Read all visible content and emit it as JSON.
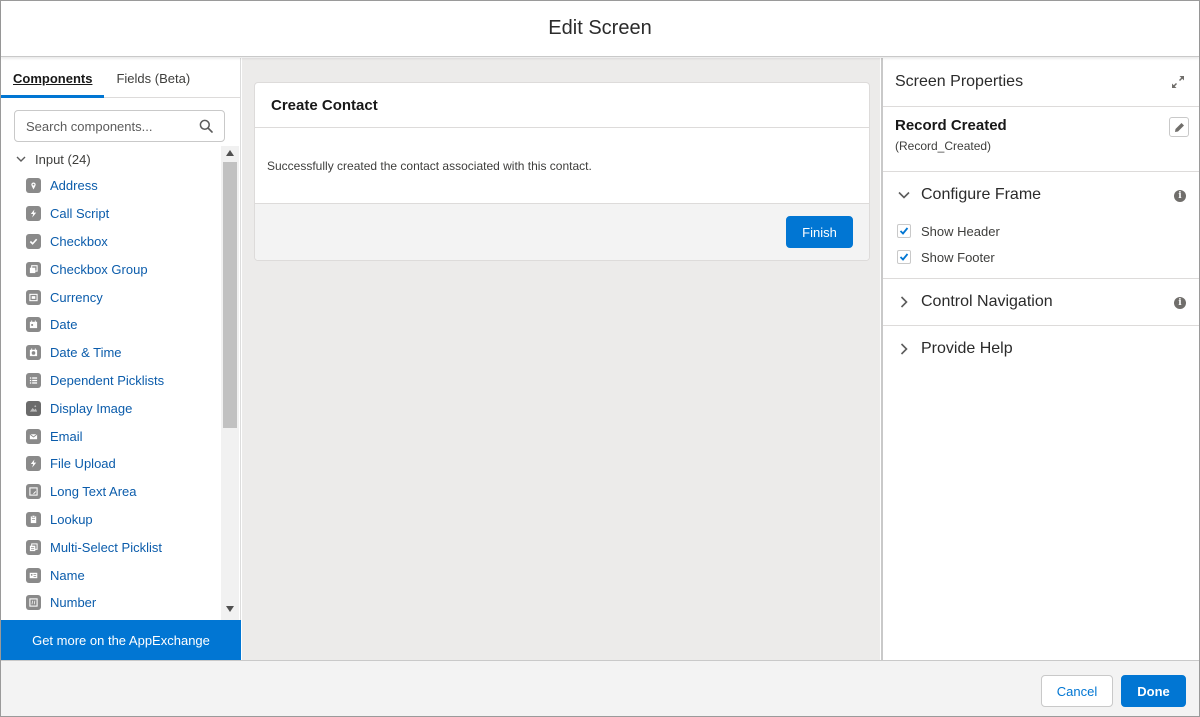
{
  "header": {
    "title": "Edit Screen"
  },
  "left": {
    "tabs": [
      {
        "label": "Components",
        "active": true
      },
      {
        "label": "Fields (Beta)",
        "active": false
      }
    ],
    "search": {
      "placeholder": "Search components..."
    },
    "group": {
      "label": "Input (24)"
    },
    "items": [
      {
        "label": "Address",
        "icon": "map-pin-icon"
      },
      {
        "label": "Call Script",
        "icon": "bolt-icon"
      },
      {
        "label": "Checkbox",
        "icon": "checkbox-icon"
      },
      {
        "label": "Checkbox Group",
        "icon": "checkbox-group-icon"
      },
      {
        "label": "Currency",
        "icon": "currency-icon"
      },
      {
        "label": "Date",
        "icon": "calendar-icon"
      },
      {
        "label": "Date & Time",
        "icon": "calendar-time-icon"
      },
      {
        "label": "Dependent Picklists",
        "icon": "list-icon"
      },
      {
        "label": "Display Image",
        "icon": "image-icon"
      },
      {
        "label": "Email",
        "icon": "email-icon"
      },
      {
        "label": "File Upload",
        "icon": "bolt-icon"
      },
      {
        "label": "Long Text Area",
        "icon": "textarea-icon"
      },
      {
        "label": "Lookup",
        "icon": "lookup-icon"
      },
      {
        "label": "Multi-Select Picklist",
        "icon": "multi-select-icon"
      },
      {
        "label": "Name",
        "icon": "name-card-icon"
      },
      {
        "label": "Number",
        "icon": "number-icon"
      }
    ],
    "appexchange": "Get more on the AppExchange"
  },
  "canvas": {
    "card": {
      "title": "Create Contact",
      "body": "Successfully created the contact associated with this contact.",
      "finish_label": "Finish"
    }
  },
  "right": {
    "title": "Screen Properties",
    "record": {
      "label": "Record Created",
      "api_name": "(Record_Created)"
    },
    "sections": {
      "configure_frame": "Configure Frame",
      "show_header": "Show Header",
      "show_footer": "Show Footer",
      "control_navigation": "Control Navigation",
      "provide_help": "Provide Help"
    }
  },
  "footer": {
    "cancel_label": "Cancel",
    "done_label": "Done"
  },
  "colors": {
    "brand": "#0176d3",
    "link": "#0b5cab",
    "icon_gray": "#8a8a8a"
  }
}
